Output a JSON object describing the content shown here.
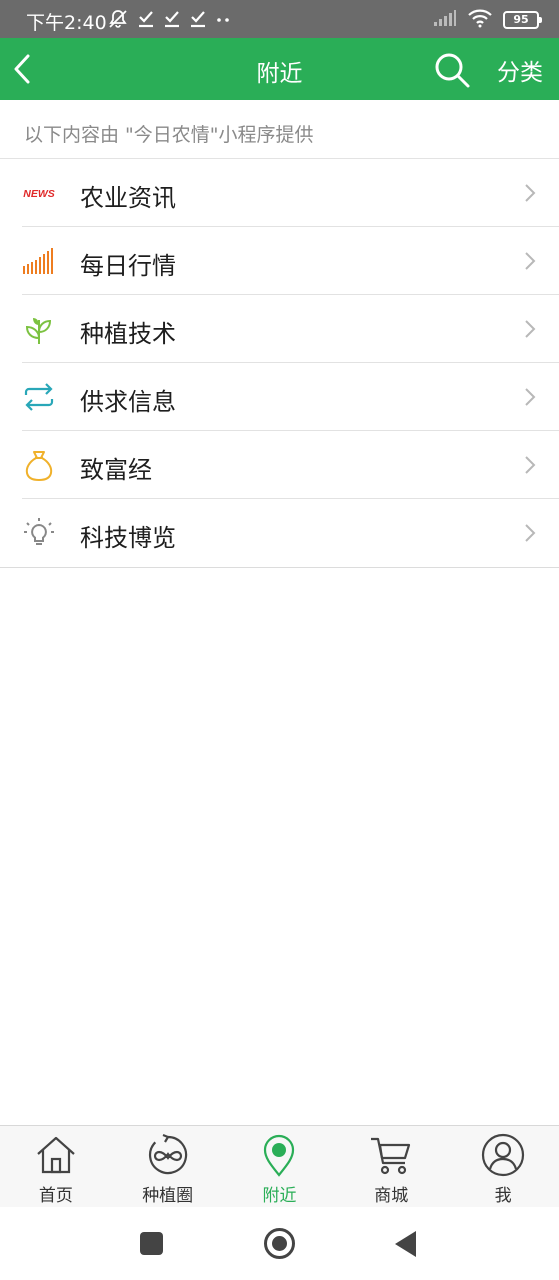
{
  "status_bar": {
    "time": "下午2:40",
    "battery": "95",
    "icons": [
      "mute-icon",
      "download-done-icon",
      "download-done-icon",
      "download-done-icon",
      "more-dots-icon",
      "signal-icon",
      "wifi-icon",
      "battery-icon"
    ]
  },
  "navbar": {
    "title": "附近",
    "category_label": "分类",
    "back_icon": "back-chevron-icon",
    "search_icon": "search-icon"
  },
  "notice": "以下内容由 \"今日农情\"小程序提供",
  "menu": {
    "items": [
      {
        "label": "农业资讯",
        "icon": "news-icon",
        "icon_text": "NEWS"
      },
      {
        "label": "每日行情",
        "icon": "market-bars-icon"
      },
      {
        "label": "种植技术",
        "icon": "sprout-icon"
      },
      {
        "label": "供求信息",
        "icon": "exchange-arrows-icon"
      },
      {
        "label": "致富经",
        "icon": "money-bag-icon"
      },
      {
        "label": "科技博览",
        "icon": "lightbulb-icon"
      }
    ]
  },
  "tabbar": {
    "active": "附近",
    "items": [
      {
        "label": "首页",
        "icon": "home-icon"
      },
      {
        "label": "种植圈",
        "icon": "circle-infinity-icon"
      },
      {
        "label": "附近",
        "icon": "location-pin-icon"
      },
      {
        "label": "商城",
        "icon": "cart-icon"
      },
      {
        "label": "我",
        "icon": "user-icon"
      }
    ]
  },
  "colors": {
    "primary": "#2aae57",
    "status_bar": "#6b6b6b",
    "news_red": "#e02a2a",
    "market_orange": "#ee7d20",
    "sprout_green": "#7cc241",
    "exchange_teal": "#29a7b8",
    "bag_yellow": "#f0b12b",
    "bulb_gray": "#888888"
  }
}
